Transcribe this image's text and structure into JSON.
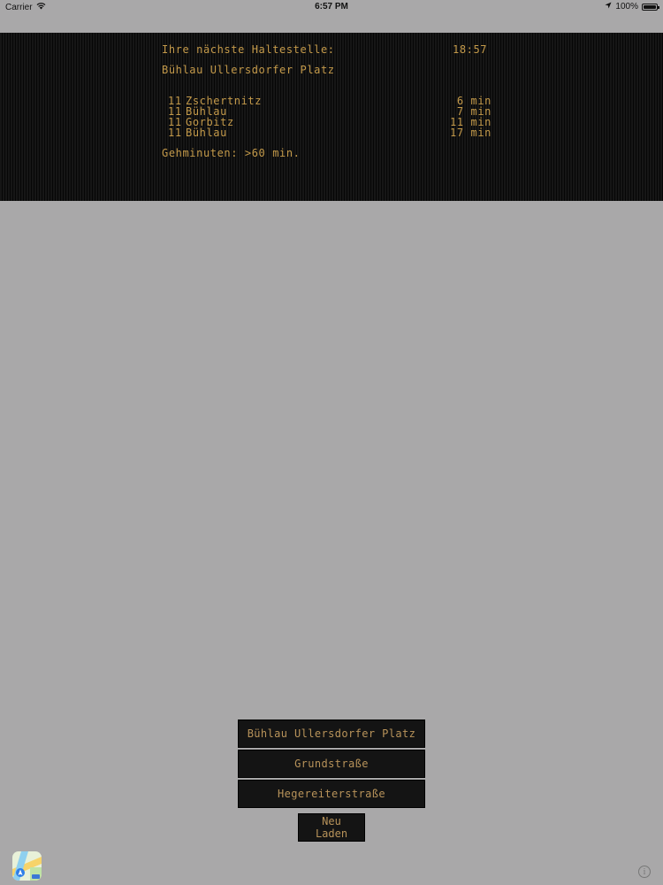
{
  "status_bar": {
    "carrier": "Carrier",
    "time": "6:57 PM",
    "battery": "100%",
    "battery_level": 1.0
  },
  "display": {
    "next_stop_label": "Ihre nächste Haltestelle:",
    "clock": "18:57",
    "current_stop": "Bühlau Ullersdorfer Platz",
    "departures": [
      {
        "line": "11",
        "destination": "Zschertnitz",
        "time": "6 min"
      },
      {
        "line": "11",
        "destination": "Bühlau",
        "time": "7 min"
      },
      {
        "line": "11",
        "destination": "Gorbitz",
        "time": "11 min"
      },
      {
        "line": "11",
        "destination": "Bühlau",
        "time": "17 min"
      }
    ],
    "walk_minutes": "Gehminuten: >60 min."
  },
  "stops": [
    {
      "label": "Bühlau Ullersdorfer Platz"
    },
    {
      "label": "Grundstraße"
    },
    {
      "label": "Hegereiterstraße"
    }
  ],
  "reload_label": "Neu Laden",
  "icons": {
    "maps": "maps-app-icon",
    "info": "info-icon",
    "location": "location-arrow-icon",
    "wifi": "wifi-icon"
  },
  "colors": {
    "background": "#a9a8a9",
    "led_text": "#c49a4a",
    "button_bg": "#141414"
  }
}
